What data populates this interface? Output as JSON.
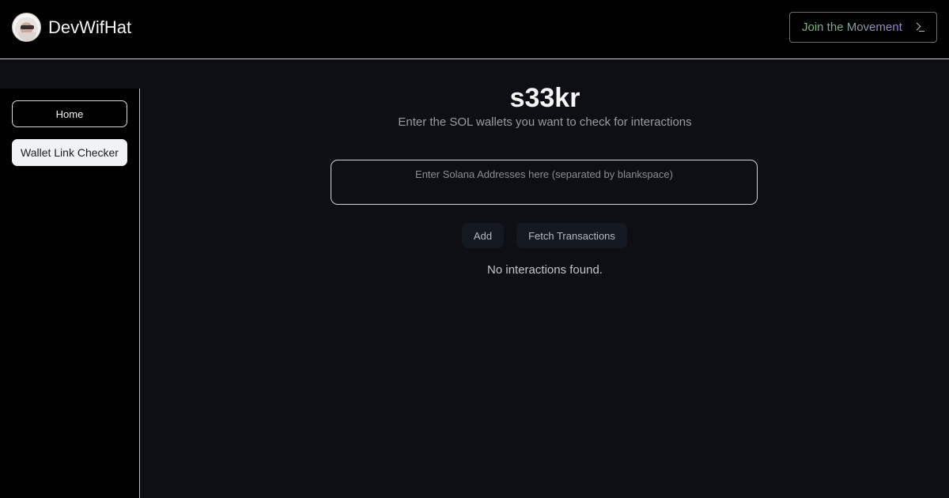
{
  "header": {
    "brand_name": "DevWifHat",
    "join_label": "Join the Movement",
    "join_icon": "terminal-icon",
    "avatar": "avatar"
  },
  "sidebar": {
    "items": [
      {
        "label": "Home",
        "active": false
      },
      {
        "label": "Wallet Link Checker",
        "active": true
      }
    ]
  },
  "main": {
    "title": "s33kr",
    "subtitle": "Enter the SOL wallets you want to check for interactions",
    "address_input": {
      "value": "",
      "placeholder": "Enter Solana Addresses here (separated by blankspace)"
    },
    "add_label": "Add",
    "fetch_label": "Fetch Transactions",
    "status_text": "No interactions found."
  },
  "colors": {
    "background": "#0d0f15",
    "topbar": "#000000",
    "join_gradient_start": "#7bbf6a",
    "join_gradient_end": "#8d86d6",
    "active_sidebar_bg": "#f1f2f5"
  }
}
